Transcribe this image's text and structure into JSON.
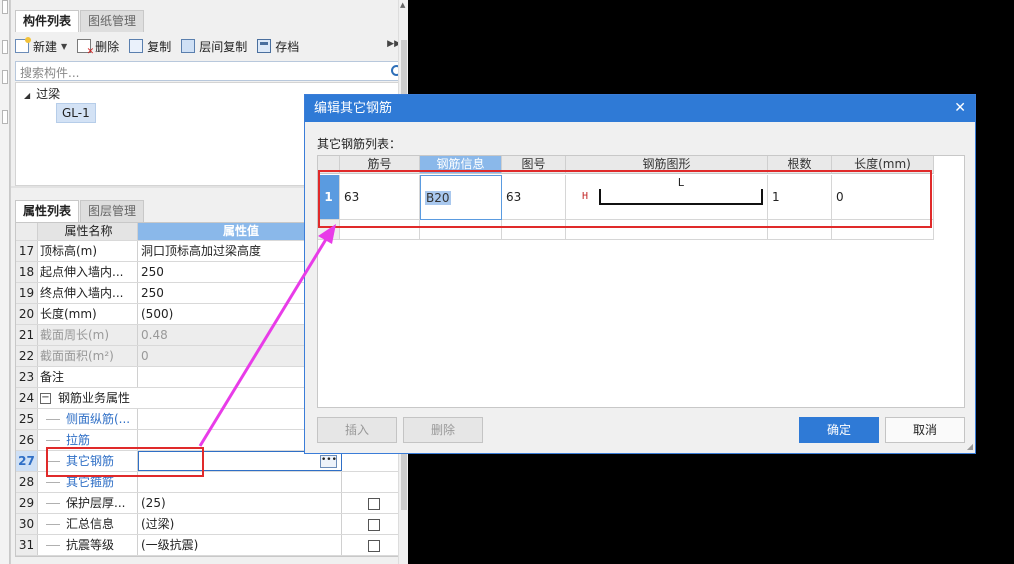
{
  "top_tabs": [
    "构件列表",
    "图纸管理"
  ],
  "toolbar": {
    "new_label": "新建",
    "delete_label": "删除",
    "copy_label": "复制",
    "floor_copy_label": "层间复制",
    "save_label": "存档"
  },
  "search": {
    "placeholder": "搜索构件..."
  },
  "tree": {
    "root": "过梁",
    "child": "GL-1"
  },
  "bottom_tabs": [
    "属性列表",
    "图层管理"
  ],
  "props": {
    "col_name": "属性名称",
    "col_value": "属性值",
    "rows": [
      {
        "n": "17",
        "name": "顶标高(m)",
        "value": "洞口顶标高加过梁高度"
      },
      {
        "n": "18",
        "name": "起点伸入墙内...",
        "value": "250"
      },
      {
        "n": "19",
        "name": "终点伸入墙内...",
        "value": "250"
      },
      {
        "n": "20",
        "name": "长度(mm)",
        "value": "(500)"
      },
      {
        "n": "21",
        "name": "截面周长(m)",
        "value": "0.48"
      },
      {
        "n": "22",
        "name": "截面面积(m²)",
        "value": "0"
      },
      {
        "n": "23",
        "name": "备注",
        "value": ""
      },
      {
        "n": "24",
        "name": "钢筋业务属性",
        "value": ""
      },
      {
        "n": "25",
        "name": "侧面纵筋(...",
        "value": ""
      },
      {
        "n": "26",
        "name": "拉筋",
        "value": ""
      },
      {
        "n": "27",
        "name": "其它钢筋",
        "value": ""
      },
      {
        "n": "28",
        "name": "其它箍筋",
        "value": ""
      },
      {
        "n": "29",
        "name": "保护层厚...",
        "value": "(25)"
      },
      {
        "n": "30",
        "name": "汇总信息",
        "value": "(过梁)"
      },
      {
        "n": "31",
        "name": "抗震等级",
        "value": "(一级抗震)"
      }
    ]
  },
  "dialog": {
    "title": "编辑其它钢筋",
    "list_label": "其它钢筋列表：",
    "columns": [
      "筋号",
      "钢筋信息",
      "图号",
      "钢筋图形",
      "根数",
      "长度(mm)"
    ],
    "row": {
      "index": "1",
      "bar_no": "63",
      "info": "B20",
      "fig_no": "63",
      "shape_left": "H",
      "shape_mid": "L",
      "count": "1",
      "length": "0"
    },
    "insert_label": "插入",
    "delete_label": "删除",
    "ok_label": "确定",
    "cancel_label": "取消"
  },
  "colors": {
    "accent": "#2f7ad6",
    "highlight_red": "#e02a2a",
    "arrow_magenta": "#e83ce8"
  }
}
